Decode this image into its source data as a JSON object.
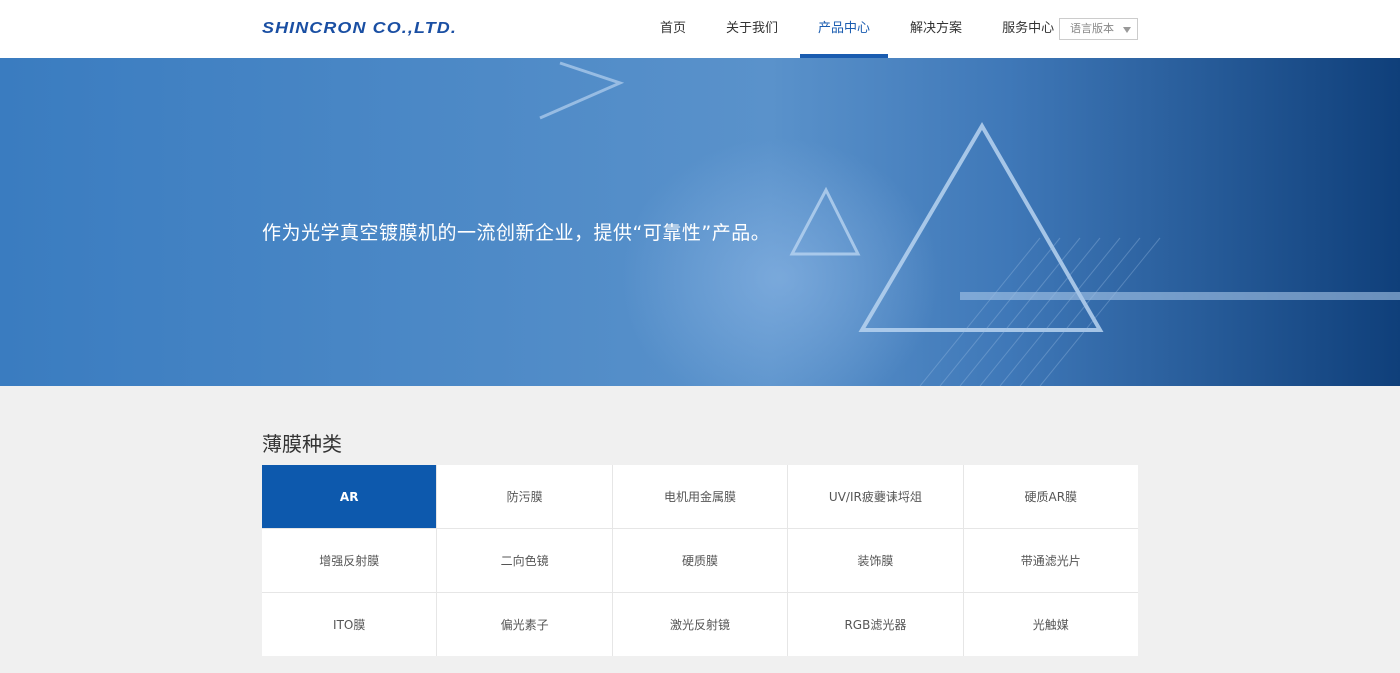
{
  "header": {
    "logo_text": "SHINCRON CO.,LTD.",
    "nav": [
      {
        "label": "首页",
        "active": false
      },
      {
        "label": "关于我们",
        "active": false
      },
      {
        "label": "产品中心",
        "active": true
      },
      {
        "label": "解决方案",
        "active": false
      },
      {
        "label": "服务中心",
        "active": false
      }
    ],
    "language_label": "语言版本"
  },
  "banner": {
    "tagline": "作为光学真空镀膜机的一流创新企业，提供“可靠性”产品。"
  },
  "section": {
    "title": "薄膜种类",
    "items": [
      {
        "label": "AR",
        "active": true
      },
      {
        "label": "防污膜",
        "active": false
      },
      {
        "label": "电机用金属膜",
        "active": false
      },
      {
        "label": "UV/IR疲虁诔埒俎",
        "active": false
      },
      {
        "label": "硬质AR膜",
        "active": false
      },
      {
        "label": "增强反射膜",
        "active": false
      },
      {
        "label": "二向色镜",
        "active": false
      },
      {
        "label": "硬质膜",
        "active": false
      },
      {
        "label": "装饰膜",
        "active": false
      },
      {
        "label": "带通滤光片",
        "active": false
      },
      {
        "label": "ITO膜",
        "active": false
      },
      {
        "label": "偏光素子",
        "active": false
      },
      {
        "label": "激光反射镜",
        "active": false
      },
      {
        "label": "RGB滤光器",
        "active": false
      },
      {
        "label": "光触媒",
        "active": false
      }
    ]
  },
  "colors": {
    "accent": "#0d59ad",
    "nav_active": "#1a5cb0",
    "logo": "#1a4fa3"
  }
}
